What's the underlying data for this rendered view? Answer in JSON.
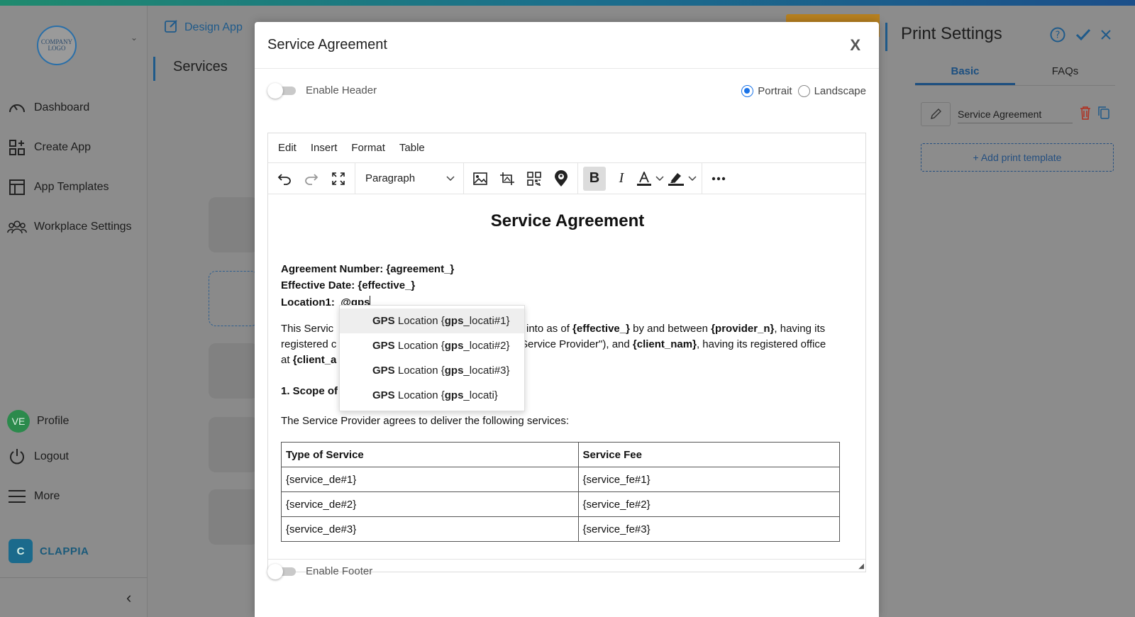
{
  "sidebar": {
    "logo_text": "COMPANY LOGO",
    "nav": [
      {
        "label": "Dashboard"
      },
      {
        "label": "Create App"
      },
      {
        "label": "App Templates"
      },
      {
        "label": "Workplace Settings"
      }
    ],
    "bottom": [
      {
        "label": "Profile",
        "avatar": "VE"
      },
      {
        "label": "Logout"
      },
      {
        "label": "More"
      }
    ],
    "brand": "CLAPPIA"
  },
  "header": {
    "design_app": "Design App",
    "section_title": "Services"
  },
  "print_settings": {
    "title": "Print Settings",
    "tabs": [
      "Basic",
      "FAQs"
    ],
    "active_tab": "Basic",
    "template_name": "Service Agreement",
    "add_template": "+ Add print template"
  },
  "modal": {
    "title": "Service Agreement",
    "close": "X",
    "enable_header": "Enable Header",
    "enable_footer": "Enable Footer",
    "orientation": {
      "portrait": "Portrait",
      "landscape": "Landscape",
      "selected": "Portrait"
    }
  },
  "editor": {
    "menu": [
      "Edit",
      "Insert",
      "Format",
      "Table"
    ],
    "block_format": "Paragraph",
    "doc": {
      "title": "Service Agreement",
      "agreement_label": "Agreement Number:",
      "agreement_value": "{agreement_}",
      "effective_label": "Effective Date:",
      "effective_value": "{effective_}",
      "location_label": "Location1:",
      "location_value": "@gps",
      "p1_start": "This Servic",
      "p1_end_a": "into as of ",
      "p1_effective": "{effective_}",
      "p1_end_b": " by and between ",
      "p1_provider": "{provider_n}",
      "p1_end_c": ", having its",
      "p2_start": "registered c",
      "p2_end_a": "Service Provider\"), and ",
      "p2_client": "{client_nam}",
      "p2_end_b": ", having its registered office",
      "p3_start": "at ",
      "p3_client": "{client_a",
      "scope_heading": "1. Scope of",
      "services_intro": "The Service Provider agrees to deliver the following services:",
      "table": {
        "headers": [
          "Type of Service",
          "Service Fee"
        ],
        "rows": [
          [
            "{service_de#1}",
            "{service_fe#1}"
          ],
          [
            "{service_de#2}",
            "{service_fe#2}"
          ],
          [
            "{service_de#3}",
            "{service_fe#3}"
          ]
        ]
      }
    },
    "mention_suggestions": [
      {
        "prefix": "GPS",
        "text": " Location {",
        "token": "gps",
        "suffix": "_locati#1}"
      },
      {
        "prefix": "GPS",
        "text": " Location {",
        "token": "gps",
        "suffix": "_locati#2}"
      },
      {
        "prefix": "GPS",
        "text": " Location {",
        "token": "gps",
        "suffix": "_locati#3}"
      },
      {
        "prefix": "GPS",
        "text": " Location {",
        "token": "gps",
        "suffix": "_locati}"
      }
    ]
  }
}
